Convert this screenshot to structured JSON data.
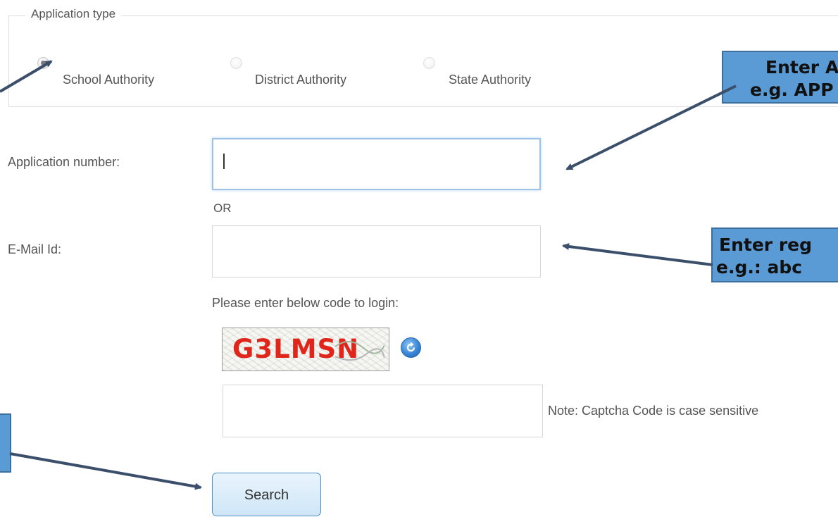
{
  "application_type": {
    "legend": "Application type",
    "options": [
      {
        "label": "School Authority",
        "selected": true
      },
      {
        "label": "District Authority",
        "selected": false
      },
      {
        "label": "State Authority",
        "selected": false
      }
    ]
  },
  "form": {
    "application_number_label": "Application number:",
    "application_number_value": "",
    "or_text": "OR",
    "email_label": "E-Mail Id:",
    "email_value": "",
    "captcha_prompt": "Please enter below code to login:",
    "captcha_code": "G3LMSN",
    "captcha_value": "",
    "captcha_note": "Note: Captcha Code is case sensitive",
    "search_label": "Search"
  },
  "callouts": {
    "application_number_line1": "Enter A",
    "application_number_line2": "e.g. APP",
    "email_line1": "Enter reg",
    "email_line2": "e.g.: abc"
  },
  "colors": {
    "callout_fill": "#5b9bd5",
    "captcha_text": "#e0251b",
    "arrow": "#3b4f6b"
  }
}
